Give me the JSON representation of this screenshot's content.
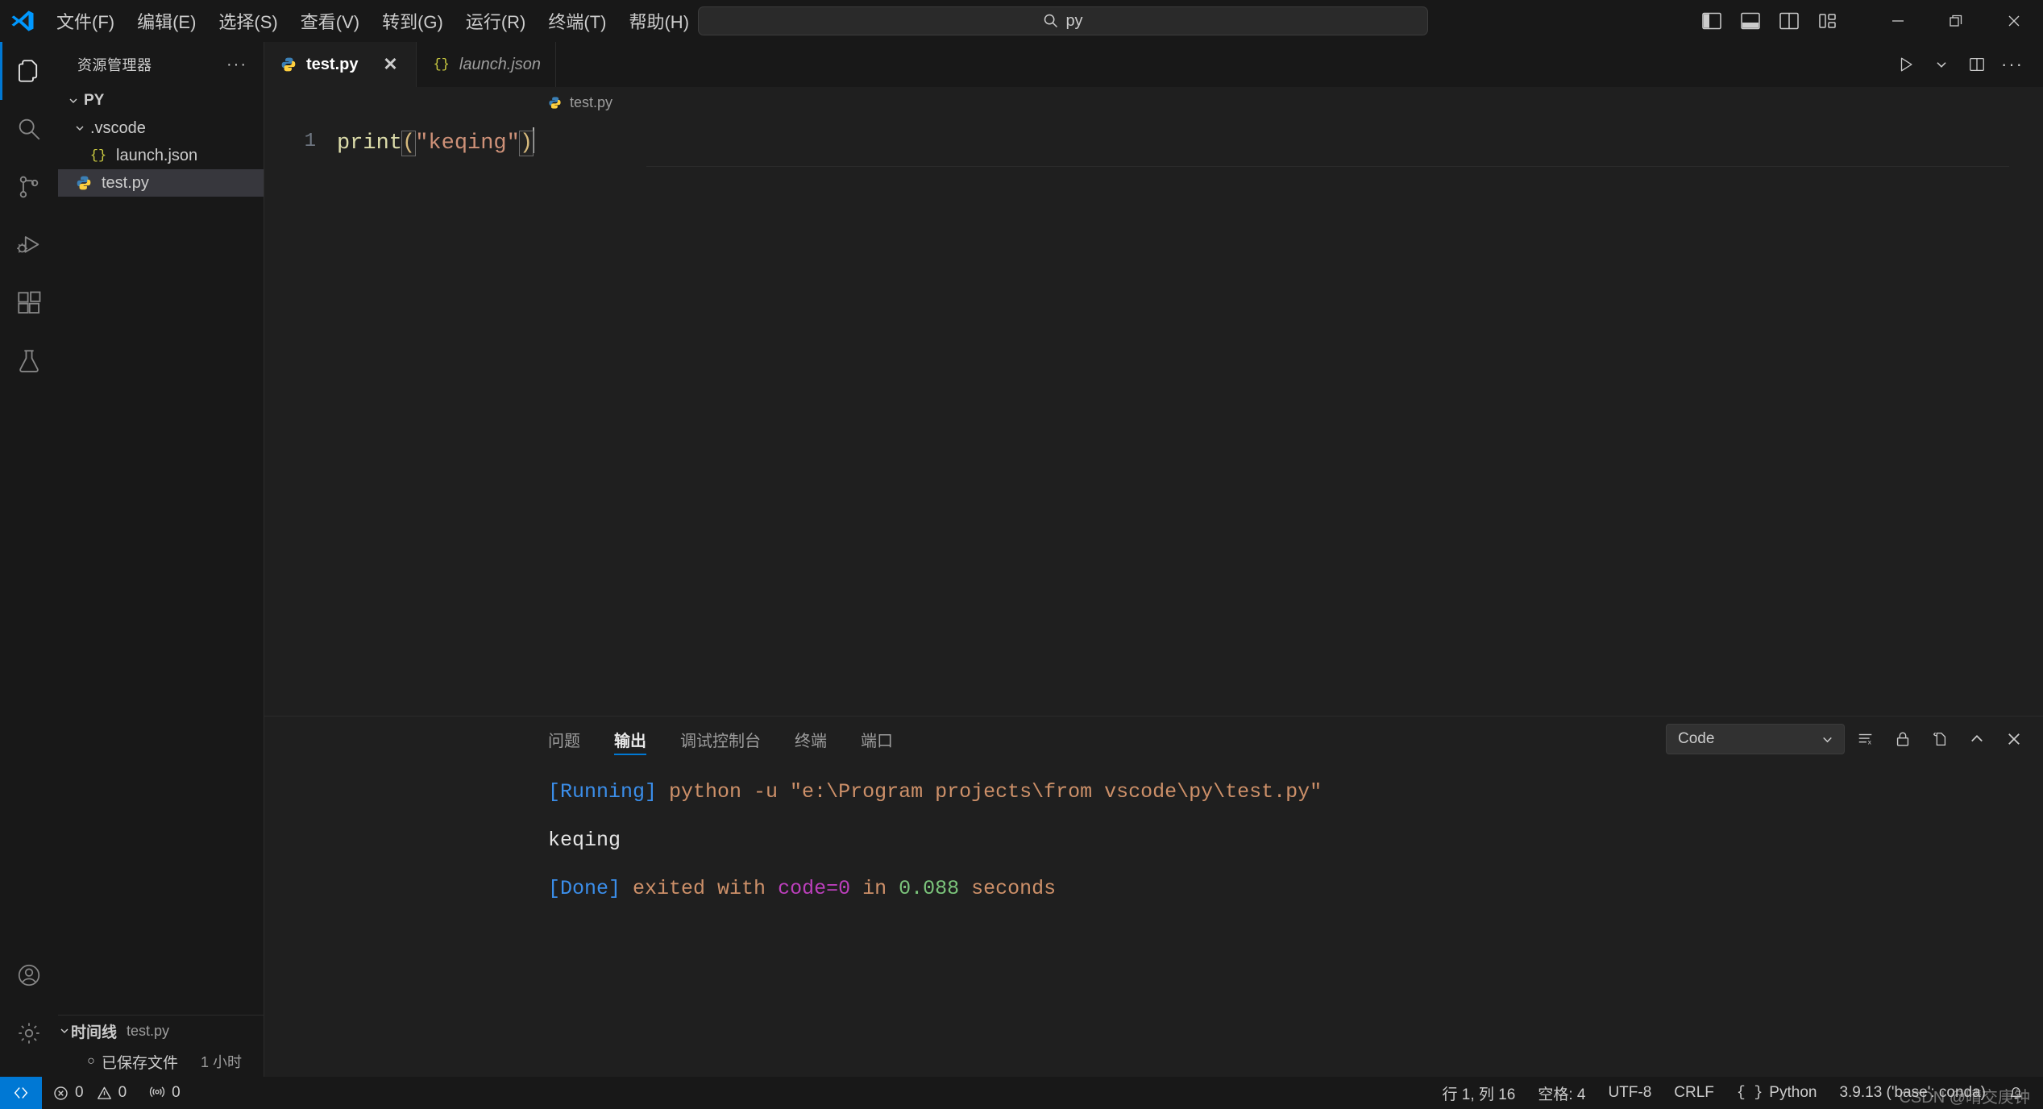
{
  "titlebar": {
    "logo": "vscode-logo",
    "menu": [
      {
        "label": "文件(F)",
        "name": "menu-file"
      },
      {
        "label": "编辑(E)",
        "name": "menu-edit"
      },
      {
        "label": "选择(S)",
        "name": "menu-selection"
      },
      {
        "label": "查看(V)",
        "name": "menu-view"
      },
      {
        "label": "转到(G)",
        "name": "menu-go"
      },
      {
        "label": "运行(R)",
        "name": "menu-run"
      },
      {
        "label": "终端(T)",
        "name": "menu-terminal"
      },
      {
        "label": "帮助(H)",
        "name": "menu-help"
      }
    ],
    "nav_back": "‹",
    "nav_forward": "›",
    "command_center": {
      "value": "py",
      "icon": "search-icon"
    },
    "layout_controls": [
      {
        "name": "toggle-primary-sidebar-icon"
      },
      {
        "name": "toggle-panel-icon"
      },
      {
        "name": "toggle-secondary-sidebar-icon"
      },
      {
        "name": "customize-layout-icon"
      }
    ],
    "window_controls": [
      {
        "name": "minimize-button",
        "glyph": "—"
      },
      {
        "name": "restore-button",
        "glyph": "❐"
      },
      {
        "name": "close-button",
        "glyph": "✕"
      }
    ]
  },
  "activitybar": {
    "items": [
      {
        "name": "activity-explorer",
        "icon": "files-icon",
        "active": true
      },
      {
        "name": "activity-search",
        "icon": "search-icon",
        "active": false
      },
      {
        "name": "activity-source-control",
        "icon": "source-control-icon",
        "active": false
      },
      {
        "name": "activity-run-debug",
        "icon": "run-and-debug-icon",
        "active": false
      },
      {
        "name": "activity-extensions",
        "icon": "extensions-icon",
        "active": false
      },
      {
        "name": "activity-testing",
        "icon": "beaker-icon",
        "active": false
      }
    ],
    "bottom": [
      {
        "name": "activity-accounts",
        "icon": "account-icon"
      },
      {
        "name": "activity-settings",
        "icon": "gear-icon"
      }
    ]
  },
  "sidebar": {
    "title": "资源管理器",
    "more_actions": "···",
    "tree": [
      {
        "label": "PY",
        "name": "folder-py",
        "level": 0,
        "expanded": true,
        "icon": "none",
        "selected": false
      },
      {
        "label": ".vscode",
        "name": "folder-vscode",
        "level": 1,
        "expanded": true,
        "icon": "none",
        "selected": false
      },
      {
        "label": "launch.json",
        "name": "file-launch-json",
        "level": 2,
        "expanded": null,
        "icon": "json-icon",
        "selected": false
      },
      {
        "label": "test.py",
        "name": "file-test-py",
        "level": 1,
        "expanded": null,
        "icon": "python-icon",
        "selected": true
      }
    ],
    "timeline": {
      "title": "时间线",
      "subtitle": "test.py",
      "entries": [
        {
          "label": "已保存文件",
          "when": "1 小时",
          "name": "timeline-entry-file-saved"
        }
      ]
    }
  },
  "editor": {
    "tabs": [
      {
        "label": "test.py",
        "name": "tab-test-py",
        "icon": "python-icon",
        "active": true,
        "italic": false,
        "close": "✕"
      },
      {
        "label": "launch.json",
        "name": "tab-launch-json",
        "icon": "json-icon",
        "active": false,
        "italic": true,
        "close": ""
      }
    ],
    "tab_actions": [
      {
        "name": "run-python-file-button",
        "icon": "play-icon"
      },
      {
        "name": "run-options-dropdown",
        "icon": "chevron-down-icon"
      },
      {
        "name": "split-editor-right-button",
        "icon": "split-editor-icon"
      },
      {
        "name": "more-editor-actions-button",
        "icon": "ellipsis-icon"
      }
    ],
    "breadcrumb": {
      "label": "test.py",
      "icon": "python-icon"
    },
    "code": {
      "line_number": "1",
      "tokens": [
        {
          "text": "print",
          "type": "function"
        },
        {
          "text": "(",
          "type": "paren-open"
        },
        {
          "text": "\"keqing\"",
          "type": "string"
        },
        {
          "text": ")",
          "type": "paren-close"
        }
      ]
    }
  },
  "panel": {
    "tabs": [
      {
        "label": "问题",
        "name": "panel-tab-problems",
        "active": false
      },
      {
        "label": "输出",
        "name": "panel-tab-output",
        "active": true
      },
      {
        "label": "调试控制台",
        "name": "panel-tab-debug-console",
        "active": false
      },
      {
        "label": "终端",
        "name": "panel-tab-terminal",
        "active": false
      },
      {
        "label": "端口",
        "name": "panel-tab-ports",
        "active": false
      }
    ],
    "channel_select": {
      "value": "Code",
      "name": "output-channel-select",
      "chevron": "chevron-down-icon"
    },
    "actions": [
      {
        "name": "clear-output-button",
        "icon": "clear-all-icon"
      },
      {
        "name": "turn-auto-scrolling-off-button",
        "icon": "lock-icon"
      },
      {
        "name": "open-output-in-editor-button",
        "icon": "open-in-editor-icon"
      },
      {
        "name": "maximize-panel-button",
        "icon": "chevron-up-icon"
      },
      {
        "name": "close-panel-button",
        "icon": "close-icon"
      }
    ],
    "output_lines": [
      {
        "name": "output-line-running",
        "segments": [
          {
            "text": "[Running] ",
            "color": "tag"
          },
          {
            "text": "python -u \"e:\\Program projects\\from vscode\\py\\test.py\"",
            "color": "text"
          }
        ]
      },
      {
        "name": "output-line-result",
        "segments": [
          {
            "text": "keqing",
            "color": "white"
          }
        ]
      },
      {
        "name": "output-line-blank",
        "segments": [
          {
            "text": " ",
            "color": "white"
          }
        ]
      },
      {
        "name": "output-line-done",
        "segments": [
          {
            "text": "[Done] ",
            "color": "tag"
          },
          {
            "text": "exited with ",
            "color": "text"
          },
          {
            "text": "code=0",
            "color": "keyword"
          },
          {
            "text": " in ",
            "color": "text"
          },
          {
            "text": "0.088",
            "color": "number"
          },
          {
            "text": " seconds",
            "color": "text"
          }
        ]
      }
    ]
  },
  "statusbar": {
    "remote_icon": "remote-window-icon",
    "left": [
      {
        "name": "status-problems",
        "icon": "error-icon",
        "errors": "0",
        "warnings": "0",
        "warn_icon": "warning-icon"
      },
      {
        "name": "status-radio-tower",
        "icon": "radio-tower-icon",
        "value": "0"
      }
    ],
    "right": [
      {
        "name": "status-cursor-position",
        "label": "行 1, 列 16"
      },
      {
        "name": "status-indentation",
        "label": "空格: 4"
      },
      {
        "name": "status-encoding",
        "label": "UTF-8"
      },
      {
        "name": "status-eol",
        "label": "CRLF"
      },
      {
        "name": "status-language-mode",
        "label": "Python",
        "icon": "python-brace-icon"
      },
      {
        "name": "status-python-interpreter",
        "label": "3.9.13 ('base': conda)"
      },
      {
        "name": "status-notifications",
        "icon": "bell-icon"
      }
    ]
  },
  "watermark": "CSDN @晴交庚钟"
}
